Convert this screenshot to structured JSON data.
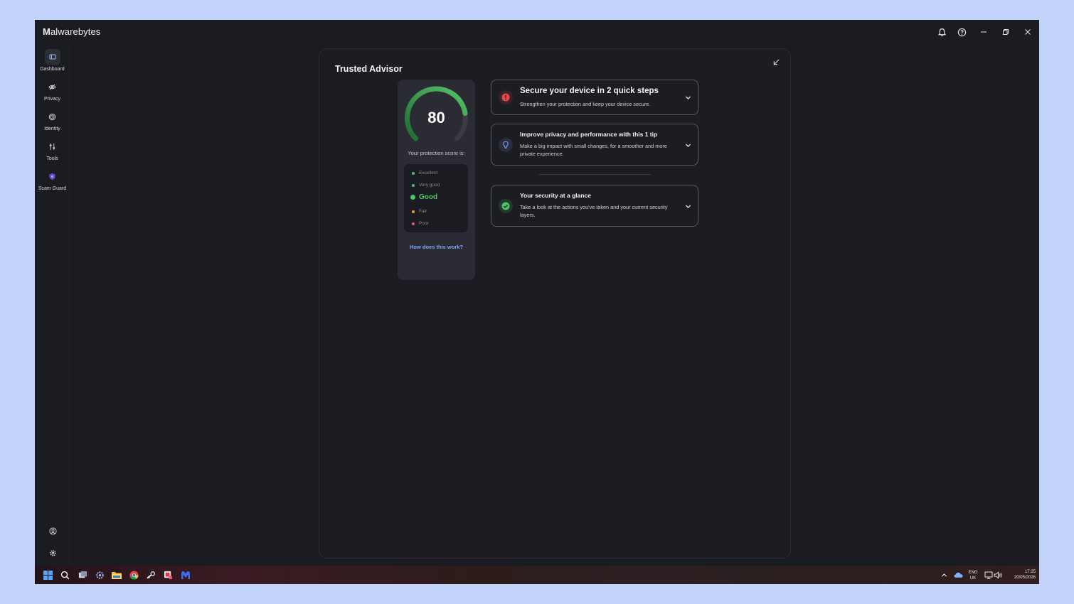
{
  "app": {
    "logo_bold": "M",
    "logo_text": "alwarebytes"
  },
  "sidebar": {
    "items": [
      {
        "label": "Dashboard",
        "icon": "dashboard-icon",
        "active": true
      },
      {
        "label": "Privacy",
        "icon": "eye-off-icon"
      },
      {
        "label": "Identity",
        "icon": "fingerprint-icon"
      },
      {
        "label": "Tools",
        "icon": "tools-icon"
      },
      {
        "label": "Scam Guard",
        "icon": "scam-guard-icon"
      }
    ],
    "bottom": [
      {
        "icon": "account-icon"
      },
      {
        "icon": "settings-icon"
      }
    ]
  },
  "panel": {
    "title": "Trusted Advisor"
  },
  "score": {
    "value": "80",
    "caption": "Your protection score is:",
    "fraction": 0.8,
    "levels": [
      {
        "label": "Excellent",
        "color": "#4cc36a"
      },
      {
        "label": "Very good",
        "color": "#4cc36a"
      },
      {
        "label": "Good",
        "color": "#4cc36a",
        "current": true
      },
      {
        "label": "Fair",
        "color": "#f2994a"
      },
      {
        "label": "Poor",
        "color": "#eb5757"
      }
    ],
    "link": "How does this work?"
  },
  "cards": [
    {
      "title": "Secure your device in 2 quick steps",
      "desc": "Strengthen your protection and keep your device secure.",
      "icon": "alert-icon",
      "status_color": "#e5484d"
    },
    {
      "title": "Improve privacy and performance with this 1 tip",
      "desc": "Make a big impact with small changes, for a smoother and more private experience.",
      "icon": "lightbulb-icon",
      "status_color": "#7ea6ff"
    },
    {
      "title": "Your security at a glance",
      "desc": "Take a look at the actions you've taken and your current security layers.",
      "icon": "check-icon",
      "status_color": "#4cc36a"
    }
  ],
  "taskbar": {
    "lang_top": "ENG",
    "lang_bottom": "UK",
    "time": "17:25",
    "date": "20/05/2026"
  },
  "colors": {
    "accent": "#4cc36a",
    "link": "#7ea6ff",
    "background": "#1b1c21"
  }
}
